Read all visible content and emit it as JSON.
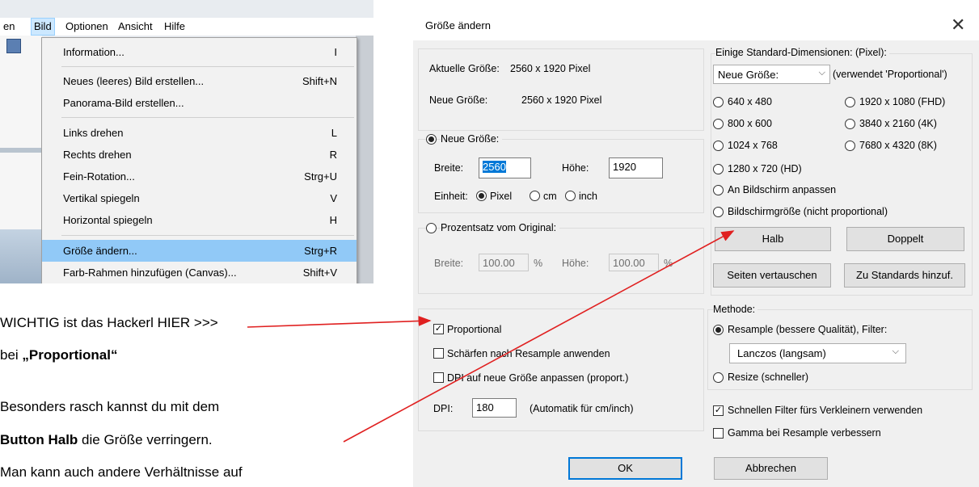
{
  "menu_screenshot": {
    "menubar": [
      "en",
      "Bild",
      "Optionen",
      "Ansicht",
      "Hilfe"
    ],
    "items": [
      {
        "label": "Information...",
        "shortcut": "I"
      },
      {
        "label": "Neues (leeres) Bild erstellen...",
        "shortcut": "Shift+N"
      },
      {
        "label": "Panorama-Bild erstellen...",
        "shortcut": ""
      },
      {
        "label": "Links drehen",
        "shortcut": "L"
      },
      {
        "label": "Rechts drehen",
        "shortcut": "R"
      },
      {
        "label": "Fein-Rotation...",
        "shortcut": "Strg+U"
      },
      {
        "label": "Vertikal spiegeln",
        "shortcut": "V"
      },
      {
        "label": "Horizontal spiegeln",
        "shortcut": "H"
      },
      {
        "label": "Größe ändern...",
        "shortcut": "Strg+R"
      },
      {
        "label": "Farb-Rahmen hinzufügen (Canvas)...",
        "shortcut": "Shift+V"
      }
    ]
  },
  "annotations": {
    "line1": "WICHTIG ist das Hackerl HIER >>>",
    "line2_prefix": "bei ",
    "line2_bold": "„Proportional“",
    "line3": "Besonders rasch kannst du mit dem",
    "line4_bold": "Button Halb",
    "line4_rest": " die Größe verringern.",
    "line5": "Man kann auch andere Verhältnisse auf"
  },
  "dialog": {
    "title": "Größe ändern",
    "close_glyph": "✕",
    "current_size_label": "Aktuelle Größe:",
    "current_size_value": "2560  x  1920  Pixel",
    "new_size_label": "Neue Größe:",
    "new_size_value": "2560  x  1920  Pixel",
    "neue_groesse_radio": "Neue Größe:",
    "breite_label": "Breite:",
    "breite_value": "2560",
    "hoehe_label": "Höhe:",
    "hoehe_value": "1920",
    "einheit_label": "Einheit:",
    "unit_pixel": "Pixel",
    "unit_cm": "cm",
    "unit_inch": "inch",
    "percent_radio": "Prozentsatz vom Original:",
    "percent_breite_label": "Breite:",
    "percent_breite_value": "100.00",
    "percent_unit": "%",
    "percent_hoehe_label": "Höhe:",
    "percent_hoehe_value": "100.00",
    "std_dims_title": "Einige Standard-Dimensionen: (Pixel):",
    "std_combo_value": "Neue Größe:",
    "std_combo_note": "(verwendet 'Proportional')",
    "std_left": [
      "640 x 480",
      "800 x 600",
      "1024 x 768",
      "1280 x 720   (HD)",
      "An Bildschirm anpassen",
      "Bildschirmgröße (nicht proportional)"
    ],
    "std_right": [
      "1920 x 1080 (FHD)",
      "3840 x 2160 (4K)",
      "7680 x 4320 (8K)"
    ],
    "btn_halb": "Halb",
    "btn_doppelt": "Doppelt",
    "btn_seiten": "Seiten vertauschen",
    "btn_standards": "Zu Standards hinzuf.",
    "proportional": "Proportional",
    "schaerfen": "Schärfen nach Resample anwenden",
    "dpi_anpassen": "DPI auf neue Größe anpassen (proport.)",
    "dpi_label": "DPI:",
    "dpi_value": "180",
    "dpi_note": "(Automatik für cm/inch)",
    "methode_title": "Methode:",
    "resample": "Resample (bessere Qualität), Filter:",
    "filter_value": "Lanczos (langsam)",
    "resize": "Resize (schneller)",
    "schnell_filter": "Schnellen Filter fürs Verkleinern verwenden",
    "gamma": "Gamma bei Resample verbessern",
    "ok": "OK",
    "abbrechen": "Abbrechen"
  },
  "colors": {
    "arrow": "#e02020",
    "menu_highlight": "#91c9f7",
    "menubar_highlight": "#cce8ff"
  }
}
